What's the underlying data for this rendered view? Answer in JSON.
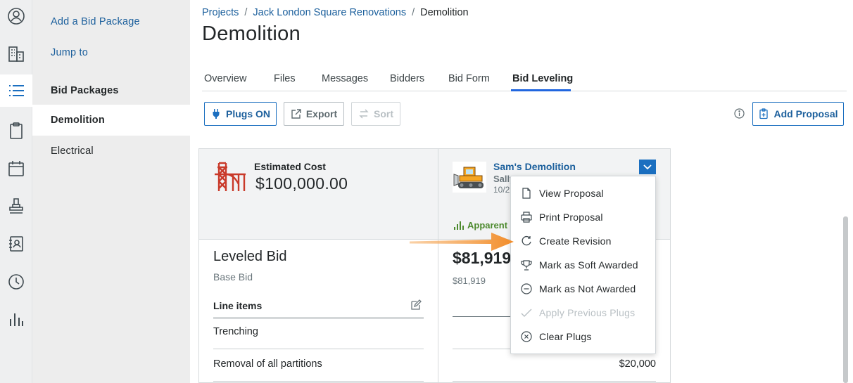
{
  "sidebar": {
    "links": [
      "Add a Bid Package",
      "Jump to"
    ],
    "items": [
      "Bid Packages",
      "Demolition",
      "Electrical"
    ]
  },
  "breadcrumb": {
    "items": [
      "Projects",
      "Jack London Square Renovations",
      "Demolition"
    ],
    "separator": "/"
  },
  "page_title": "Demolition",
  "tabs": [
    "Overview",
    "Files",
    "Messages",
    "Bidders",
    "Bid Form",
    "Bid Leveling"
  ],
  "active_tab": "Bid Leveling",
  "toolbar": {
    "plugs": "Plugs ON",
    "export": "Export",
    "sort": "Sort",
    "add_proposal": "Add Proposal"
  },
  "estimate": {
    "label": "Estimated Cost",
    "value": "$100,000.00"
  },
  "leveled": {
    "title": "Leveled Bid",
    "subtitle": "Base Bid",
    "line_items_label": "Line items",
    "rows": [
      "Trenching",
      "Removal of all partitions"
    ]
  },
  "bidder": {
    "name": "Sam's Demolition",
    "contact": "Sally",
    "date": "10/2",
    "status": "Apparent L",
    "amount": "$81,919",
    "amount_sub": "$81,919",
    "row_value": "$20,000"
  },
  "menu": {
    "items": [
      {
        "label": "View Proposal",
        "icon": "document-icon",
        "disabled": false
      },
      {
        "label": "Print Proposal",
        "icon": "printer-icon",
        "disabled": false
      },
      {
        "label": "Create Revision",
        "icon": "refresh-icon",
        "disabled": false
      },
      {
        "label": "Mark as Soft Awarded",
        "icon": "trophy-icon",
        "disabled": false
      },
      {
        "label": "Mark as Not Awarded",
        "icon": "minus-circle-icon",
        "disabled": false
      },
      {
        "label": "Apply Previous Plugs",
        "icon": "checkmark-icon",
        "disabled": true
      },
      {
        "label": "Clear Plugs",
        "icon": "x-circle-icon",
        "disabled": false
      }
    ]
  },
  "colors": {
    "accent": "#1b6fc0",
    "link": "#1b5f9c",
    "annotation_arrow": "#f28c28",
    "success": "#4d8a2e"
  }
}
